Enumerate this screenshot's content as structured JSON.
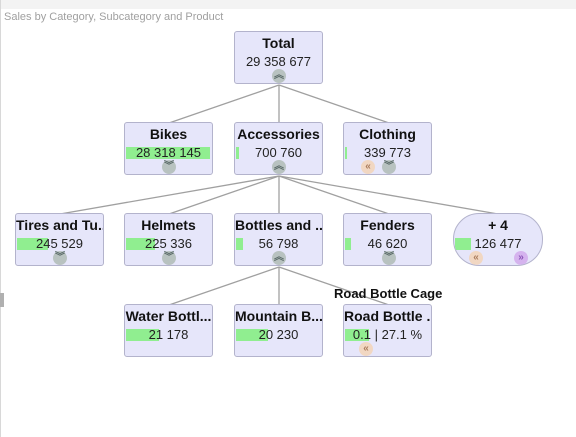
{
  "title": "Sales by Category, Subcategory and Product",
  "tooltip": "Road Bottle Cage",
  "colors": {
    "node_bg": "#e6e6fa",
    "bar": "#90ee90",
    "edge": "#a0a0a0"
  },
  "nodes": {
    "total": {
      "name": "Total",
      "value": "29 358 677",
      "bar": 0
    },
    "bikes": {
      "name": "Bikes",
      "value": "28 318 145",
      "bar": 0.97
    },
    "accessories": {
      "name": "Accessories",
      "value": "700 760",
      "bar": 0.03
    },
    "clothing": {
      "name": "Clothing",
      "value": "339 773",
      "bar": 0.02
    },
    "tires": {
      "name": "Tires and Tu...",
      "value": "245 529",
      "bar": 0.35
    },
    "helmets": {
      "name": "Helmets",
      "value": "225 336",
      "bar": 0.32
    },
    "bottles": {
      "name": "Bottles and ...",
      "value": "56 798",
      "bar": 0.08
    },
    "fenders": {
      "name": "Fenders",
      "value": "46 620",
      "bar": 0.07
    },
    "more": {
      "name": "+ 4",
      "value": "126 477",
      "bar": 0.18
    },
    "water": {
      "name": "Water Bottl...",
      "value": "21 178",
      "bar": 0.37
    },
    "mountain": {
      "name": "Mountain B...",
      "value": "20 230",
      "bar": 0.36
    },
    "road": {
      "name": "Road Bottle ...",
      "value": "0.1 | 27.1 %",
      "bar": 0.27
    }
  },
  "icons": {
    "collapse": "collapse-icon",
    "expand": "expand-icon",
    "previous": "previous-icon",
    "next": "next-icon"
  }
}
